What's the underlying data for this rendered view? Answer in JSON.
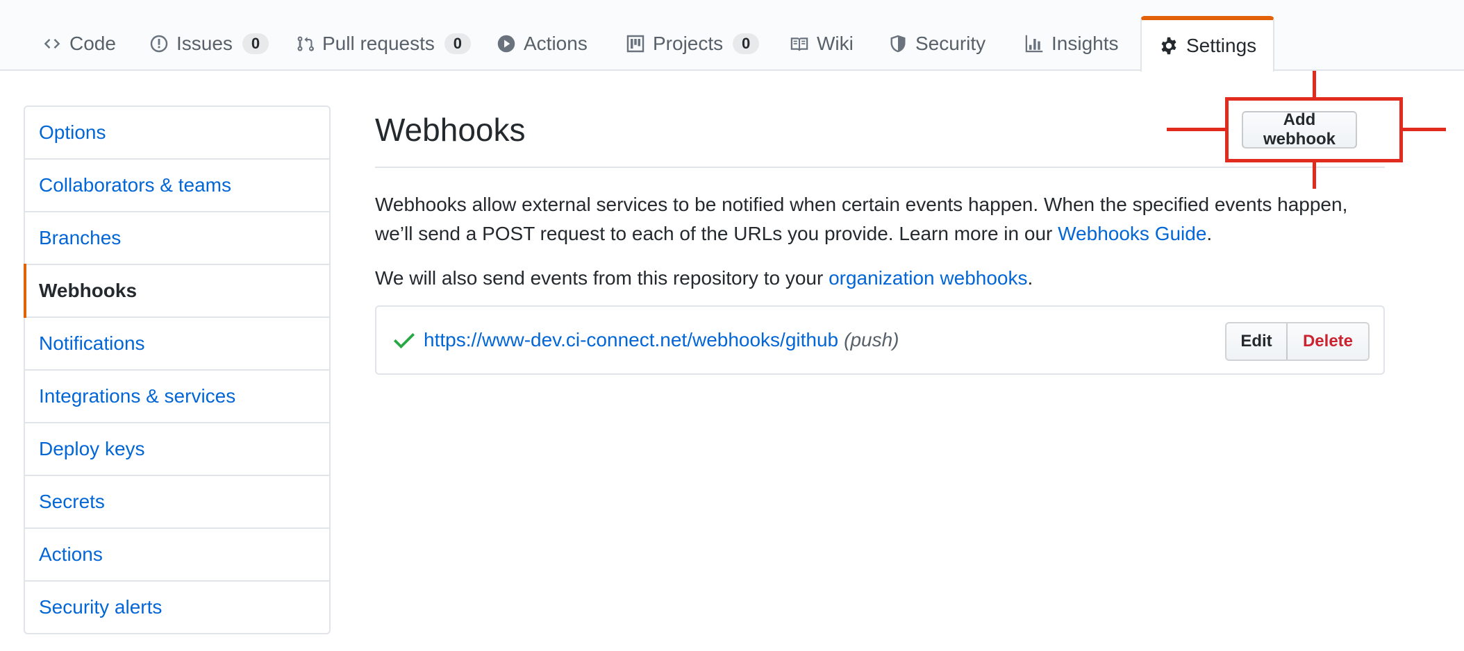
{
  "tabs": [
    {
      "label": "Code",
      "icon": "code-icon"
    },
    {
      "label": "Issues",
      "icon": "issue-opened-icon",
      "count": "0"
    },
    {
      "label": "Pull requests",
      "icon": "git-pull-request-icon",
      "count": "0"
    },
    {
      "label": "Actions",
      "icon": "play-icon"
    },
    {
      "label": "Projects",
      "icon": "project-icon",
      "count": "0"
    },
    {
      "label": "Wiki",
      "icon": "book-icon"
    },
    {
      "label": "Security",
      "icon": "shield-icon"
    },
    {
      "label": "Insights",
      "icon": "graph-icon"
    },
    {
      "label": "Settings",
      "icon": "gear-icon",
      "selected": true
    }
  ],
  "sidebar": {
    "items": [
      {
        "label": "Options"
      },
      {
        "label": "Collaborators & teams"
      },
      {
        "label": "Branches"
      },
      {
        "label": "Webhooks",
        "selected": true
      },
      {
        "label": "Notifications"
      },
      {
        "label": "Integrations & services"
      },
      {
        "label": "Deploy keys"
      },
      {
        "label": "Secrets"
      },
      {
        "label": "Actions"
      },
      {
        "label": "Security alerts"
      }
    ]
  },
  "main": {
    "title": "Webhooks",
    "add_button_label": "Add webhook",
    "description_text": "Webhooks allow external services to be notified when certain events happen. When the specified events happen, we’ll send a POST request to each of the URLs you provide. Learn more in our ",
    "guide_link": "Webhooks Guide",
    "period": ".",
    "org_text": "We will also send events from this repository to your ",
    "org_link": "organization webhooks",
    "webhook": {
      "status_icon": "check-icon",
      "url": "https://www-dev.ci-connect.net/webhooks/github",
      "events": "(push)",
      "edit_label": "Edit",
      "delete_label": "Delete"
    }
  },
  "colors": {
    "accent_tab": "#e36209",
    "link": "#0366d6",
    "danger": "#cb2431",
    "success": "#28a745",
    "annotation": "#e22b1f"
  }
}
